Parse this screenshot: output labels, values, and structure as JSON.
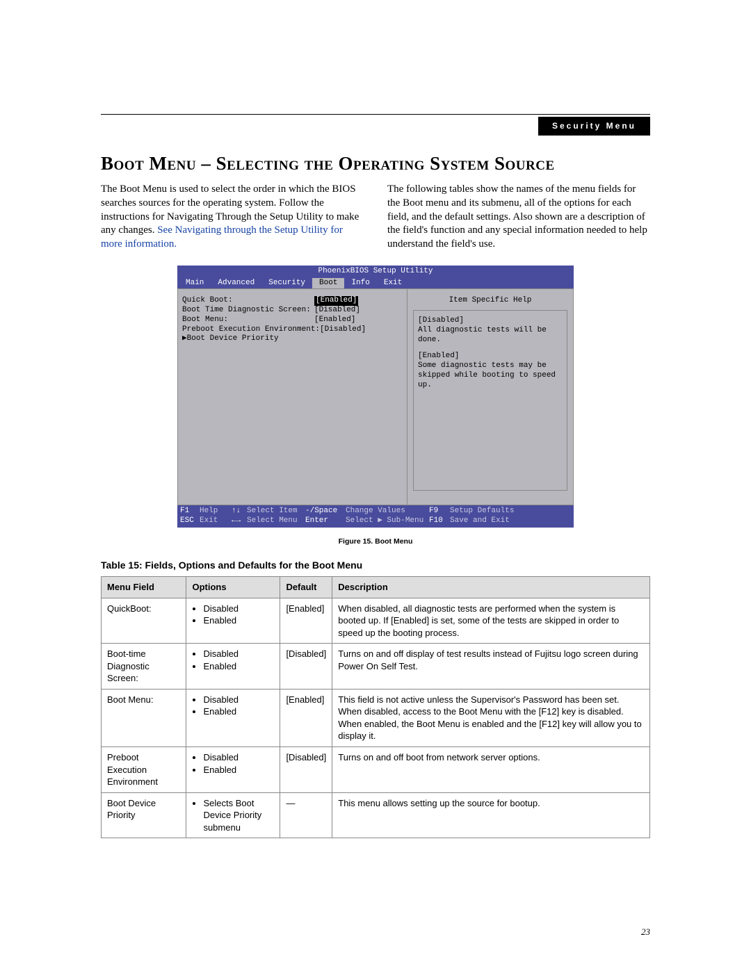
{
  "header": {
    "tag": "Security Menu"
  },
  "page": {
    "title": "Boot Menu – Selecting the Operating System Source",
    "col1_a": "The Boot Menu is used to select the order in which the BIOS searches sources for the operating system. Follow the instructions for Navigating Through the Setup Utility to make any changes. ",
    "col1_link": "See Navigating through the Setup Utility for more information.",
    "col2": "The following tables show the names of the menu fields for the Boot menu and its submenu, all of the options for each field, and the default settings. Also shown are a description of the field's function and any special information needed to help understand the field's use.",
    "number": "23"
  },
  "bios": {
    "title": "PhoenixBIOS Setup Utility",
    "tabs": [
      "Main",
      "Advanced",
      "Security",
      "Boot",
      "Info",
      "Exit"
    ],
    "selected_tab": "Boot",
    "items": [
      {
        "label": "Quick Boot:",
        "value": "[Enabled]",
        "hl": true
      },
      {
        "label": "Boot Time Diagnostic Screen:",
        "value": "[Disabled]",
        "hl": false
      },
      {
        "label": "Boot Menu:",
        "value": "[Enabled]",
        "hl": false
      },
      {
        "label": "Preboot Execution Environment:",
        "value": "[Disabled]",
        "hl": false
      }
    ],
    "submenu": "Boot Device Priority",
    "help": {
      "title": "Item Specific Help",
      "p1a": "[Disabled]",
      "p1b": "All diagnostic tests will be done.",
      "p2a": "[Enabled]",
      "p2b": "Some diagnostic tests may be skipped while booting to speed up."
    },
    "footer": {
      "f1": "F1",
      "help": "Help",
      "ud": "↑↓",
      "sel_item": "Select Item",
      "mspace": "-/Space",
      "chg": "Change Values",
      "f9": "F9",
      "setup_def": "Setup Defaults",
      "esc": "ESC",
      "exit": "Exit",
      "lr": "←→",
      "sel_menu": "Select Menu",
      "enter": "Enter",
      "sub": "Select ▶ Sub-Menu",
      "f10": "F10",
      "save": "Save and Exit"
    }
  },
  "figure_caption": "Figure 15.  Boot Menu",
  "table_caption": "Table 15: Fields, Options and Defaults for the Boot Menu",
  "table": {
    "head": [
      "Menu Field",
      "Options",
      "Default",
      "Description"
    ],
    "rows": [
      {
        "field": "QuickBoot:",
        "opts": [
          "Disabled",
          "Enabled"
        ],
        "def": "[Enabled]",
        "desc": "When disabled, all diagnostic tests are performed when the system is booted up. If [Enabled] is set, some of the tests are skipped in order to speed up the booting process."
      },
      {
        "field": "Boot-time Diagnostic Screen:",
        "opts": [
          "Disabled",
          "Enabled"
        ],
        "def": "[Disabled]",
        "desc": "Turns on and off display of test results instead of Fujitsu logo screen during Power On Self Test."
      },
      {
        "field": "Boot Menu:",
        "opts": [
          "Disabled",
          "Enabled"
        ],
        "def": "[Enabled]",
        "desc": "This field is not active unless the Supervisor's Password has been set. When disabled, access to the Boot Menu with the [F12] key is disabled. When enabled, the Boot Menu is enabled and the [F12] key will allow you to display it."
      },
      {
        "field": "Preboot Execution Environment",
        "opts": [
          "Disabled",
          "Enabled"
        ],
        "def": "[Disabled]",
        "desc": "Turns on and off boot from network server options."
      },
      {
        "field": "Boot Device Priority",
        "opts": [
          "Selects Boot Device Priority submenu"
        ],
        "def": "—",
        "desc": "This menu allows setting up the source for bootup."
      }
    ]
  }
}
